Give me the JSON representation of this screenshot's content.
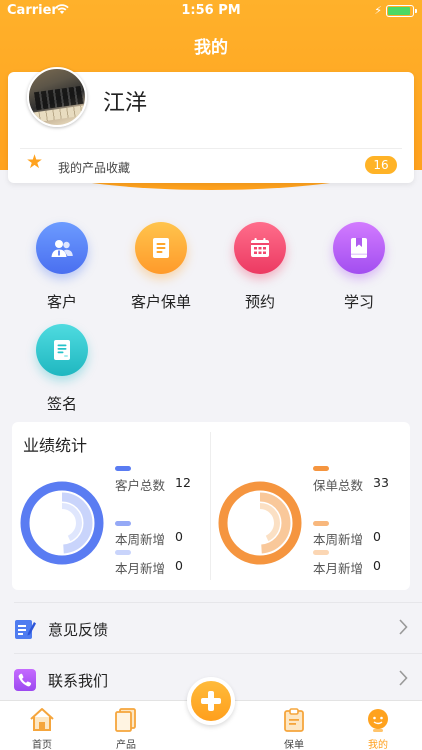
{
  "status_bar": {
    "carrier": "Carrier",
    "time": "1:56 PM"
  },
  "nav": {
    "title": "我的"
  },
  "profile": {
    "name": "江洋",
    "favorites_label": "我的产品收藏",
    "favorites_count": "16"
  },
  "functions": [
    {
      "label": "客户",
      "icon": "customers-icon",
      "color": "#4f7cf0"
    },
    {
      "label": "客户保单",
      "icon": "policy-doc-icon",
      "color": "#ffa726"
    },
    {
      "label": "预约",
      "icon": "calendar-icon",
      "color": "#f2476e"
    },
    {
      "label": "学习",
      "icon": "book-icon",
      "color": "#b05cf0"
    },
    {
      "label": "签名",
      "icon": "signature-icon",
      "color": "#25c2c9"
    }
  ],
  "stats": {
    "title": "业绩统计",
    "customers": {
      "total_label": "客户总数",
      "total": "12",
      "week_label": "本周新增",
      "week": "0",
      "month_label": "本月新增",
      "month": "0",
      "color": "#5a7cf2"
    },
    "policies": {
      "total_label": "保单总数",
      "total": "33",
      "week_label": "本周新增",
      "week": "0",
      "month_label": "本月新增",
      "month": "0",
      "color": "#f5953f"
    }
  },
  "menu": [
    {
      "label": "意见反馈",
      "icon": "feedback-icon"
    },
    {
      "label": "联系我们",
      "icon": "phone-icon"
    }
  ],
  "tabbar": {
    "items": [
      {
        "label": "首页",
        "icon": "home-icon"
      },
      {
        "label": "产品",
        "icon": "product-icon"
      },
      {
        "label": "保单",
        "icon": "clipboard-icon"
      },
      {
        "label": "我的",
        "icon": "profile-icon",
        "active": true
      }
    ],
    "active_color": "#ff9f1c"
  }
}
